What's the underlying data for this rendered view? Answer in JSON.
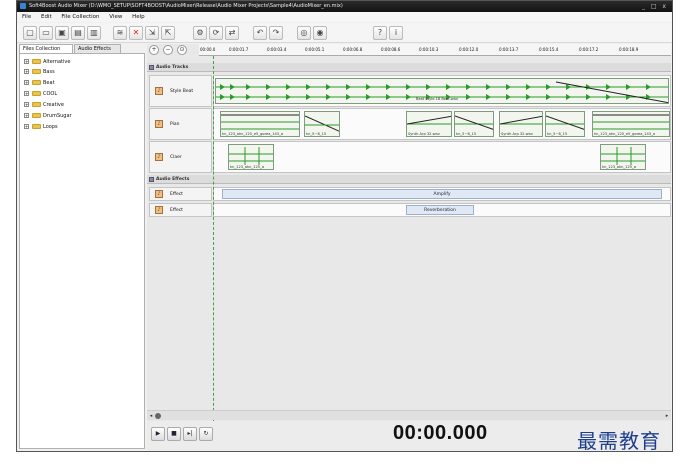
{
  "window": {
    "title": "Soft4Boost Audio Mixer (D:\\WMO_SETUP\\SOFT4BOOST\\AudioMixer\\Release\\Audio Mixer Projects\\Sample4\\AudioMixer_en.mix)",
    "controls": "_ □ x"
  },
  "menu": [
    "File",
    "Edit",
    "File Collection",
    "View",
    "Help"
  ],
  "toolbar_icons": [
    "new-file-icon",
    "open-folder-icon",
    "save-icon",
    "save-all-icon",
    "save-as-icon",
    "mix-icon",
    "delete-icon",
    "import-icon",
    "export-icon",
    "settings-icon",
    "refresh-icon",
    "share-icon",
    "undo-icon",
    "redo-icon",
    "burn-icon",
    "record-icon",
    "help-icon",
    "info-icon"
  ],
  "left": {
    "tabs": [
      "Files Collection",
      "Audio Effects"
    ],
    "tree": [
      "Alternative",
      "Bass",
      "Beat",
      "COOL",
      "Creative",
      "DrumSugar",
      "Loops"
    ]
  },
  "ruler": [
    "00:00.0",
    "0:00:01.7",
    "0:00:03.4",
    "0:00:05.1",
    "0:00:06.8",
    "0:00:08.6",
    "0:00:10.3",
    "0:00:12.0",
    "0:00:13.7",
    "0:00:15.4",
    "0:00:17.2",
    "0:00:18.9"
  ],
  "sections": {
    "tracks": "Audio Tracks",
    "effects": "Audio Effects"
  },
  "tracks": [
    {
      "name": "Style Beat"
    },
    {
      "name": "Pian"
    },
    {
      "name": "Claer"
    }
  ],
  "clips": {
    "style_label": "Beat Style 18 Beat.wav",
    "pian": [
      "kn_123_akn_125_e5_gorea_143_a",
      "kn_5~8_15",
      "Synth Arp 32.wav",
      "kn_5~8_15",
      "Synth Arp 32.wav",
      "kn_5~8_15",
      "kn_123_akn_125_e5_gorea_143_a"
    ],
    "claer": [
      "kn_123_akn_125_a",
      "kn_123_akn_125_a"
    ]
  },
  "effects": [
    {
      "name": "Effect",
      "value": "Amplify"
    },
    {
      "name": "Effect",
      "value": "Reverberation"
    }
  ],
  "timer": "00:00.000",
  "watermark": "最需教育",
  "colors": {
    "titlebar": "#1a1a1a",
    "wave": "#2a9a2a",
    "clip_border": "#7e9c7e",
    "effect_bar": "#dfe8f4",
    "watermark": "#1e3f8f"
  }
}
